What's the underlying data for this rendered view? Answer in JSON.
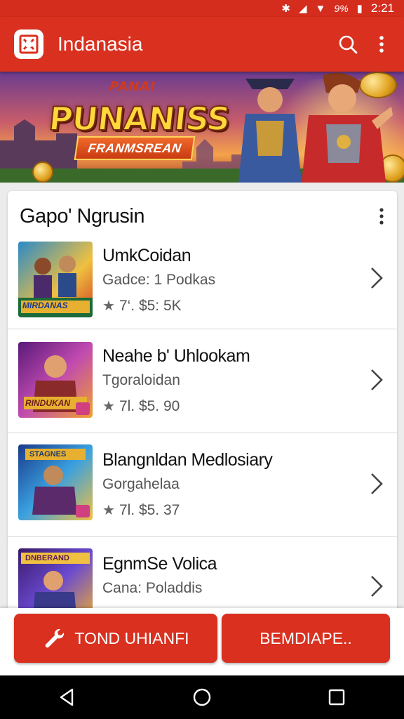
{
  "status_bar": {
    "time": "2:21",
    "battery": "9%"
  },
  "app_bar": {
    "title": "Indanasia"
  },
  "banner": {
    "small_text": "PANAI",
    "title": "PUNANISS",
    "ribbon": "FRANMSREAN"
  },
  "section": {
    "title": "Gapo' Ngrusin"
  },
  "items": [
    {
      "name": "UmkCoidan",
      "subtitle": "Gadce: 1 Podkas",
      "rating": "7‘. $5: 5K",
      "thumb_label": "MIRDANAS"
    },
    {
      "name": "Neahe b' Uhlookam",
      "subtitle": "Tgoraloidan",
      "rating": "7l. $5. 90",
      "thumb_label": "RINDUKAN"
    },
    {
      "name": "Blangnldan Medlosiary",
      "subtitle": "Gorgahelaa",
      "rating": "7l. $5. 37",
      "thumb_label": "STAGNES"
    },
    {
      "name": "EgnmSe Volica",
      "subtitle": "Cana: Poladdis",
      "rating": "",
      "thumb_label": "DNBERAND"
    }
  ],
  "actions": {
    "primary_label": "TOND UHIANFI",
    "secondary_label": "BEMDIAPE.."
  },
  "colors": {
    "brand": "#d9301f",
    "text": "#111111",
    "muted": "#555555"
  }
}
